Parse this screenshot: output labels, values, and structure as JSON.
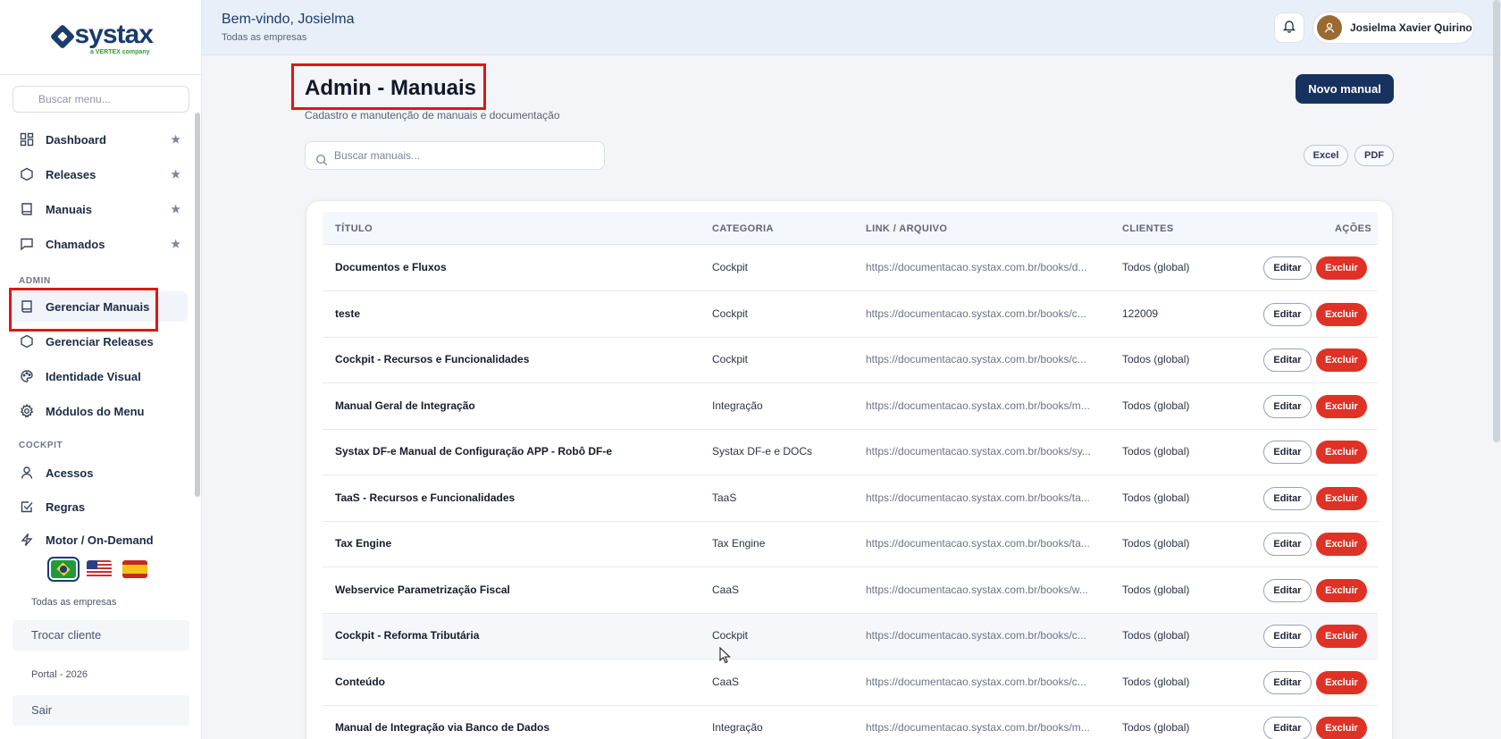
{
  "sidebar": {
    "logo_word": "systax",
    "logo_sub": "a VERTEX company",
    "search_placeholder": "Buscar menu...",
    "favorites": [
      {
        "label": "Dashboard",
        "icon": "dashboard-icon"
      },
      {
        "label": "Releases",
        "icon": "hexagon-icon"
      },
      {
        "label": "Manuais",
        "icon": "book-icon"
      },
      {
        "label": "Chamados",
        "icon": "chat-icon"
      }
    ],
    "section_admin": "ADMIN",
    "admin_items": [
      {
        "label": "Gerenciar Manuais",
        "icon": "book-icon",
        "active": true
      },
      {
        "label": "Gerenciar Releases",
        "icon": "hexagon-icon"
      },
      {
        "label": "Identidade Visual",
        "icon": "palette-icon"
      },
      {
        "label": "Módulos do Menu",
        "icon": "gear-icon"
      }
    ],
    "section_cockpit": "COCKPIT",
    "cockpit_items": [
      {
        "label": "Acessos",
        "icon": "user-icon"
      },
      {
        "label": "Regras",
        "icon": "checkbox-icon"
      },
      {
        "label": "Motor / On-Demand",
        "icon": "bolt-icon"
      }
    ],
    "company_scope": "Todas as empresas",
    "switch_client": "Trocar cliente",
    "portal_year": "Portal - 2026",
    "logout": "Sair"
  },
  "topbar": {
    "welcome": "Bem-vindo, Josielma",
    "scope": "Todas as empresas",
    "user_name": "Josielma Xavier Quirino"
  },
  "page": {
    "title": "Admin - Manuais",
    "subtitle": "Cadastro e manutenção de manuais e documentação",
    "new_button": "Novo manual",
    "search_placeholder": "Buscar manuais...",
    "export_excel": "Excel",
    "export_pdf": "PDF"
  },
  "table": {
    "headers": {
      "title": "TÍTULO",
      "category": "CATEGORIA",
      "link": "LINK / ARQUIVO",
      "clients": "CLIENTES",
      "actions": "AÇÕES"
    },
    "edit_label": "Editar",
    "delete_label": "Excluir",
    "rows": [
      {
        "title": "Documentos e Fluxos",
        "category": "Cockpit",
        "link": "https://documentacao.systax.com.br/books/d...",
        "clients": "Todos (global)"
      },
      {
        "title": "teste",
        "category": "Cockpit",
        "link": "https://documentacao.systax.com.br/books/c...",
        "clients": "122009"
      },
      {
        "title": "Cockpit - Recursos e Funcionalidades",
        "category": "Cockpit",
        "link": "https://documentacao.systax.com.br/books/c...",
        "clients": "Todos (global)"
      },
      {
        "title": "Manual Geral de Integração",
        "category": "Integração",
        "link": "https://documentacao.systax.com.br/books/m...",
        "clients": "Todos (global)"
      },
      {
        "title": "Systax DF-e Manual de Configuração APP - Robô DF-e",
        "category": "Systax DF-e e DOCs",
        "link": "https://documentacao.systax.com.br/books/sy...",
        "clients": "Todos (global)"
      },
      {
        "title": "TaaS - Recursos e Funcionalidades",
        "category": "TaaS",
        "link": "https://documentacao.systax.com.br/books/ta...",
        "clients": "Todos (global)"
      },
      {
        "title": "Tax Engine",
        "category": "Tax Engine",
        "link": "https://documentacao.systax.com.br/books/ta...",
        "clients": "Todos (global)"
      },
      {
        "title": "Webservice Parametrização Fiscal",
        "category": "CaaS",
        "link": "https://documentacao.systax.com.br/books/w...",
        "clients": "Todos (global)"
      },
      {
        "title": "Cockpit - Reforma Tributária",
        "category": "Cockpit",
        "link": "https://documentacao.systax.com.br/books/c...",
        "clients": "Todos (global)"
      },
      {
        "title": "Conteúdo",
        "category": "CaaS",
        "link": "https://documentacao.systax.com.br/books/c...",
        "clients": "Todos (global)"
      },
      {
        "title": "Manual de Integração via Banco de Dados",
        "category": "Integração",
        "link": "https://documentacao.systax.com.br/books/m...",
        "clients": "Todos (global)"
      }
    ]
  },
  "colors": {
    "brand": "#1a3b6e",
    "danger": "#e03127",
    "highlight": "#e01515"
  }
}
